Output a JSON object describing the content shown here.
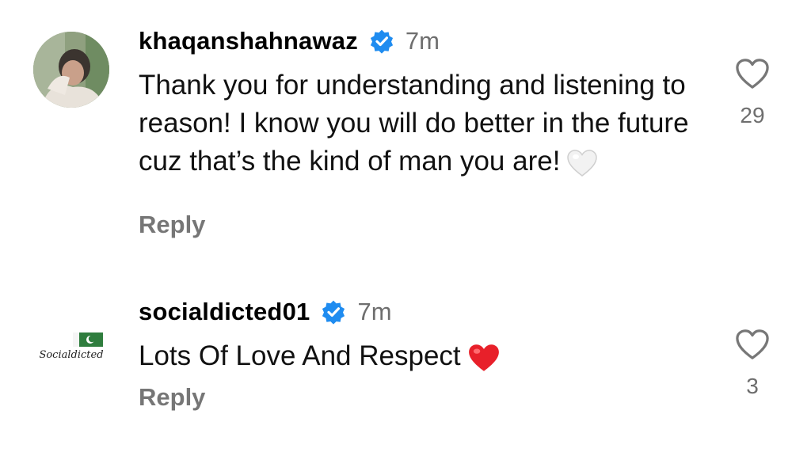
{
  "comments": [
    {
      "username": "khaqanshahnawaz",
      "time": "7m",
      "text": "Thank you for understanding and listening to reason! I know you will do better in the future cuz that’s the kind of man you are!",
      "emoji": "white-heart",
      "reply_label": "Reply",
      "like_count": "29",
      "avatar": "profile-photo"
    },
    {
      "username": "socialdicted01",
      "time": "7m",
      "text": "Lots Of Love And Respect",
      "emoji": "red-heart",
      "reply_label": "Reply",
      "like_count": "3",
      "avatar": "socialdicted-logo",
      "avatar_text": "Socialdicted"
    }
  ],
  "colors": {
    "verified_blue": "#1f8cf0",
    "secondary_text": "#6e6e6e",
    "red_heart": "#e8202a"
  }
}
